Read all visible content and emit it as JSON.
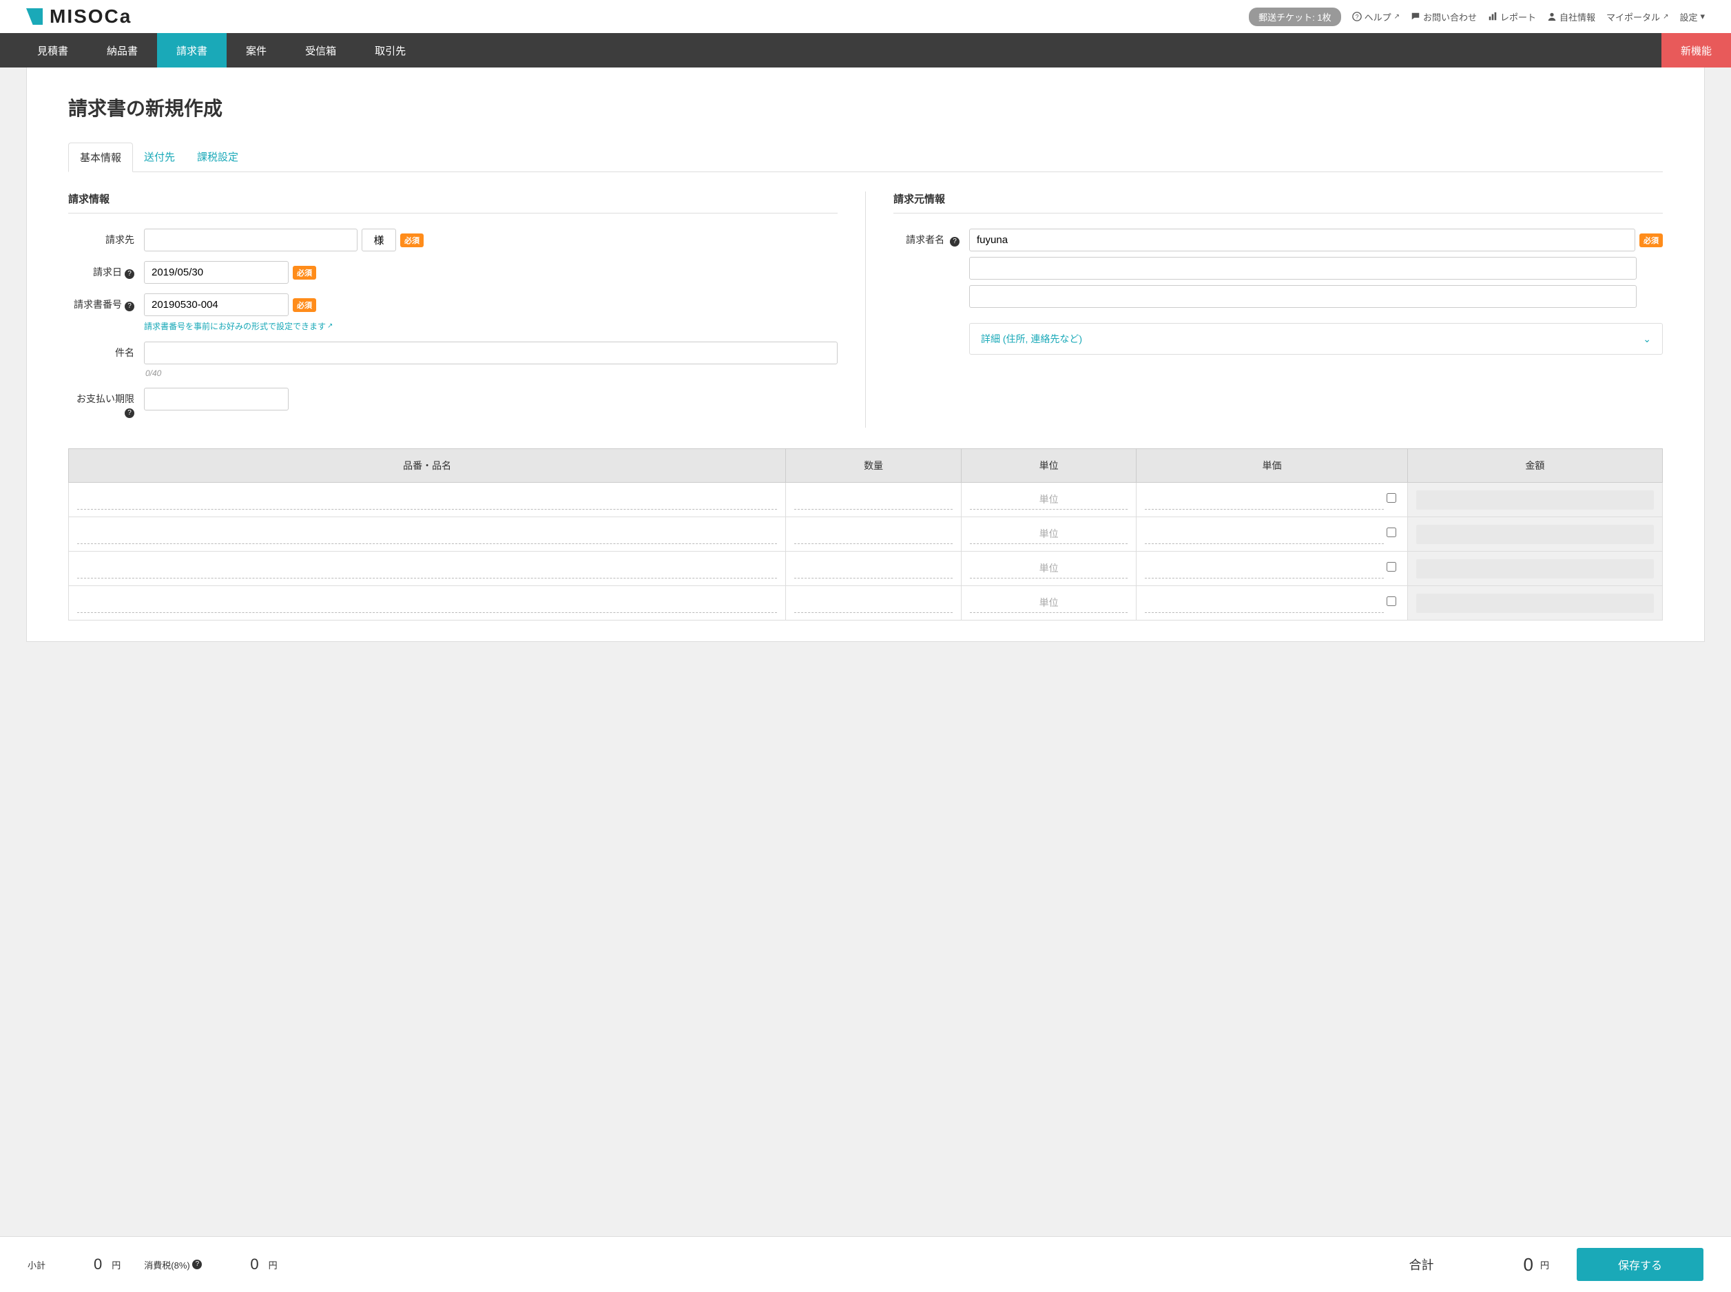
{
  "logo_text": "MISOCa",
  "topbar": {
    "ticket": "郵送チケット: 1枚",
    "help": "ヘルプ",
    "contact": "お問い合わせ",
    "report": "レポート",
    "company": "自社情報",
    "portal": "マイポータル",
    "settings": "設定"
  },
  "nav": {
    "estimate": "見積書",
    "delivery": "納品書",
    "invoice": "請求書",
    "project": "案件",
    "inbox": "受信箱",
    "client": "取引先",
    "new_feature": "新機能"
  },
  "page_title": "請求書の新規作成",
  "tabs": {
    "basic": "基本情報",
    "destination": "送付先",
    "tax": "課税設定"
  },
  "section": {
    "billing": "請求情報",
    "sender": "請求元情報"
  },
  "labels": {
    "bill_to": "請求先",
    "honorific": "様",
    "bill_date": "請求日",
    "invoice_no": "請求書番号",
    "subject": "件名",
    "due": "お支払い期限",
    "sender_name": "請求者名",
    "required": "必須"
  },
  "values": {
    "bill_date": "2019/05/30",
    "invoice_no": "20190530-004",
    "sender_name": "fuyuna",
    "subject_counter": "0/40"
  },
  "hints": {
    "invoice_no": "請求書番号を事前にお好みの形式で設定できます"
  },
  "expand": {
    "detail": "詳細 (住所, 連絡先など)"
  },
  "table": {
    "item": "品番・品名",
    "qty": "数量",
    "unit": "単位",
    "price": "単価",
    "amount": "金額",
    "unit_placeholder": "単位"
  },
  "footer": {
    "subtotal_label": "小計",
    "subtotal_val": "0",
    "yen": "円",
    "tax_label": "消費税(8%)",
    "tax_val": "0",
    "total_label": "合計",
    "total_val": "0",
    "save": "保存する"
  }
}
